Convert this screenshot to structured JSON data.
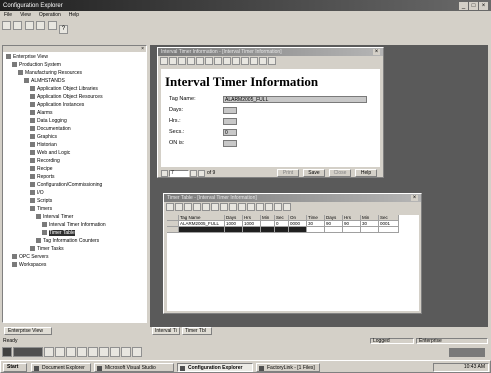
{
  "app": {
    "title": "Configuration Explorer",
    "menu": [
      "File",
      "View",
      "Operation",
      "Help"
    ]
  },
  "tree": {
    "items": [
      {
        "label": "Enterprise View",
        "indent": 0
      },
      {
        "label": "Production System",
        "indent": 1
      },
      {
        "label": "Manufacturing Resources",
        "indent": 2
      },
      {
        "label": "ALMHSTANDS",
        "indent": 3
      },
      {
        "label": "Application Object Libraries",
        "indent": 4
      },
      {
        "label": "Application Object Resources",
        "indent": 4
      },
      {
        "label": "Application Instances",
        "indent": 4
      },
      {
        "label": "Alarms",
        "indent": 4
      },
      {
        "label": "Data Logging",
        "indent": 4
      },
      {
        "label": "Documentation",
        "indent": 4
      },
      {
        "label": "Graphics",
        "indent": 4
      },
      {
        "label": "Historian",
        "indent": 4
      },
      {
        "label": "Web and Logic",
        "indent": 4
      },
      {
        "label": "Recording",
        "indent": 4
      },
      {
        "label": "Recipe",
        "indent": 4
      },
      {
        "label": "Reports",
        "indent": 4
      },
      {
        "label": "Configuration/Commissioning",
        "indent": 4
      },
      {
        "label": "I/O",
        "indent": 4
      },
      {
        "label": "Scripts",
        "indent": 4
      },
      {
        "label": "Timers",
        "indent": 4
      },
      {
        "label": "Interval Timer",
        "indent": 5
      },
      {
        "label": "Interval Timer Information",
        "indent": 6
      },
      {
        "label": "Timer Table",
        "indent": 6
      },
      {
        "label": "Tag Information Counters",
        "indent": 5
      },
      {
        "label": "Timer Tasks",
        "indent": 4
      },
      {
        "label": "OPC Servers",
        "indent": 1
      },
      {
        "label": "Workspaces",
        "indent": 1
      }
    ],
    "bottom_tab": "Enterprise View"
  },
  "form_window": {
    "title": "Interval Timer Information - [Interval Timer Information]",
    "heading": "Interval Timer Information",
    "fields": [
      {
        "label": "Tag Name:",
        "value": "ALARM2005_FULL"
      },
      {
        "label": "Days:",
        "value": ""
      },
      {
        "label": "Hrs.:",
        "value": ""
      },
      {
        "label": "Secs.:",
        "value": "0"
      },
      {
        "label": "ON is:",
        "value": ""
      }
    ],
    "record_value": "7",
    "record_suffix": "of 9",
    "buttons": [
      "Print",
      "Save",
      "Close",
      "Help"
    ]
  },
  "table_window": {
    "title": "Timer Table - [Interval Timer Information]",
    "columns": [
      "",
      "Tag Name",
      "Days",
      "Hrs",
      "Min",
      "Sec",
      "On",
      "Time",
      "Days",
      "Hrs",
      "Min",
      "Sec"
    ],
    "rows": [
      [
        "",
        "ALARM2005_FULL",
        "1000",
        "1000",
        "",
        "0",
        "0000",
        "30",
        "90",
        "90",
        "30",
        "0001"
      ],
      [
        "",
        "",
        "",
        "",
        "",
        "",
        "",
        "",
        "",
        "",
        "",
        ""
      ]
    ]
  },
  "bottom_tabs": [
    "Interval Ti",
    "Timer Tbl"
  ],
  "status": {
    "left": "Ready",
    "right1": "Logged",
    "right2": "Enterprise"
  },
  "taskbar": {
    "start": "Start",
    "tasks": [
      "Document Explorer",
      "Microsoft Visual Studio",
      "Configuration Explorer",
      "FactoryLink - [1 Files]"
    ],
    "active_index": 2,
    "clock": "10:43 AM"
  }
}
